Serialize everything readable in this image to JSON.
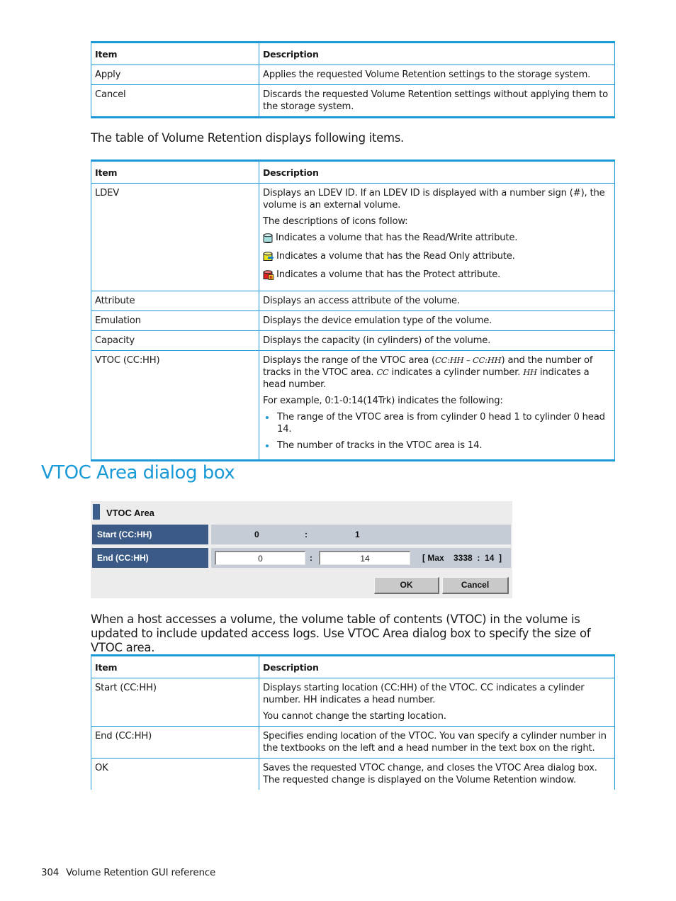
{
  "table1": {
    "headers": [
      "Item",
      "Description"
    ],
    "rows": [
      {
        "item": "Apply",
        "desc": "Applies the requested Volume Retention settings to the storage system."
      },
      {
        "item": "Cancel",
        "desc": "Discards the requested Volume Retention settings without applying them to the storage system."
      }
    ]
  },
  "intro_text": "The table of Volume Retention displays following items.",
  "table2": {
    "headers": [
      "Item",
      "Description"
    ],
    "ldev": {
      "item": "LDEV",
      "desc": "Displays an LDEV ID. If an LDEV ID is displayed with a number sign (#), the volume is an external volume.",
      "icons_intro": "The descriptions of icons follow:",
      "icons": [
        {
          "icon": "read-write-volume-icon",
          "color": "#a8e0e0",
          "text": "Indicates a volume that has the Read/Write attribute."
        },
        {
          "icon": "read-only-volume-icon",
          "color": "#e6e020",
          "text": "Indicates a volume that has the Read Only attribute."
        },
        {
          "icon": "protect-volume-icon",
          "color": "#e02020",
          "text": "Indicates a volume that has the Protect attribute."
        }
      ]
    },
    "rows": [
      {
        "item": "Attribute",
        "desc": "Displays an access attribute of the volume."
      },
      {
        "item": "Emulation",
        "desc": "Displays the device emulation type of the volume."
      },
      {
        "item": "Capacity",
        "desc": "Displays the capacity (in cylinders) of the volume."
      }
    ],
    "vtoc": {
      "item": "VTOC (CC:HH)",
      "desc_1": "Displays the range of the VTOC area (",
      "code_1": "CC:HH – CC:HH",
      "desc_2": ") and the number of tracks in the VTOC area. ",
      "code_2": "CC",
      "desc_3": " indicates a cylinder number. ",
      "code_3": "HH",
      "desc_4": " indicates a head number.",
      "example": "For example, 0:1-0:14(14Trk) indicates the following:",
      "bullets": [
        "The range of the VTOC area is from cylinder 0 head 1 to cylinder 0 head 14.",
        "The number of tracks in the VTOC area is 14."
      ]
    }
  },
  "section_heading": "VTOC Area dialog box",
  "dialog": {
    "title": "VTOC Area",
    "start_label": "Start (CC:HH)",
    "start_cc": "0",
    "start_sep": ":",
    "start_hh": "1",
    "end_label": "End (CC:HH)",
    "end_cc": "0",
    "end_sep": ":",
    "end_hh": "14",
    "max_text": "[ Max    3338  :  14  ]",
    "ok_label": "OK",
    "cancel_label": "Cancel"
  },
  "body_text": "When a host accesses a volume, the volume table of contents (VTOC) in the volume is updated to include updated access logs. Use VTOC Area dialog box to specify the size of VTOC area.",
  "table3": {
    "headers": [
      "Item",
      "Description"
    ],
    "rows": [
      {
        "item": "Start (CC:HH)",
        "desc": "Displays starting location (CC:HH) of the VTOC. CC indicates a cylinder number. HH indicates a head number.",
        "desc2": "You cannot change the starting location."
      },
      {
        "item": "End (CC:HH)",
        "desc": "Specifies ending location of the VTOC. You van specify a cylinder number in the textbooks on the left and a head number in the text box on the right."
      },
      {
        "item": "OK",
        "desc": "Saves the requested VTOC change, and closes the VTOC Area dialog box. The requested change is displayed on the Volume Retention window."
      }
    ]
  },
  "footer": {
    "page_number": "304",
    "section": "Volume Retention GUI reference"
  }
}
